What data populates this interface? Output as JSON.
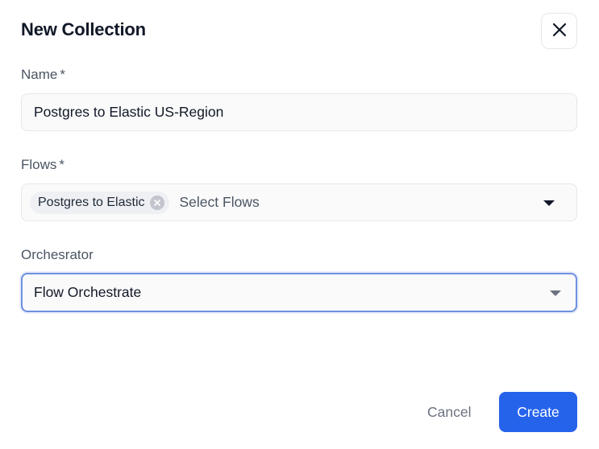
{
  "dialog": {
    "title": "New Collection",
    "close_icon": "close-icon"
  },
  "name_field": {
    "label": "Name",
    "required_mark": "*",
    "value": "Postgres to Elastic US-Region"
  },
  "flows_field": {
    "label": "Flows",
    "required_mark": "*",
    "selected_chips": [
      "Postgres to Elastic"
    ],
    "placeholder": "Select Flows",
    "dropdown_icon": "caret-down-icon"
  },
  "orchestrator_field": {
    "label": "Orchesrator",
    "value": "Flow Orchestrate",
    "dropdown_icon": "caret-down-icon"
  },
  "footer": {
    "cancel_label": "Cancel",
    "create_label": "Create"
  },
  "colors": {
    "primary": "#2563eb",
    "focus_border": "#6f8fe0",
    "chip_bg": "#eef0f3"
  }
}
